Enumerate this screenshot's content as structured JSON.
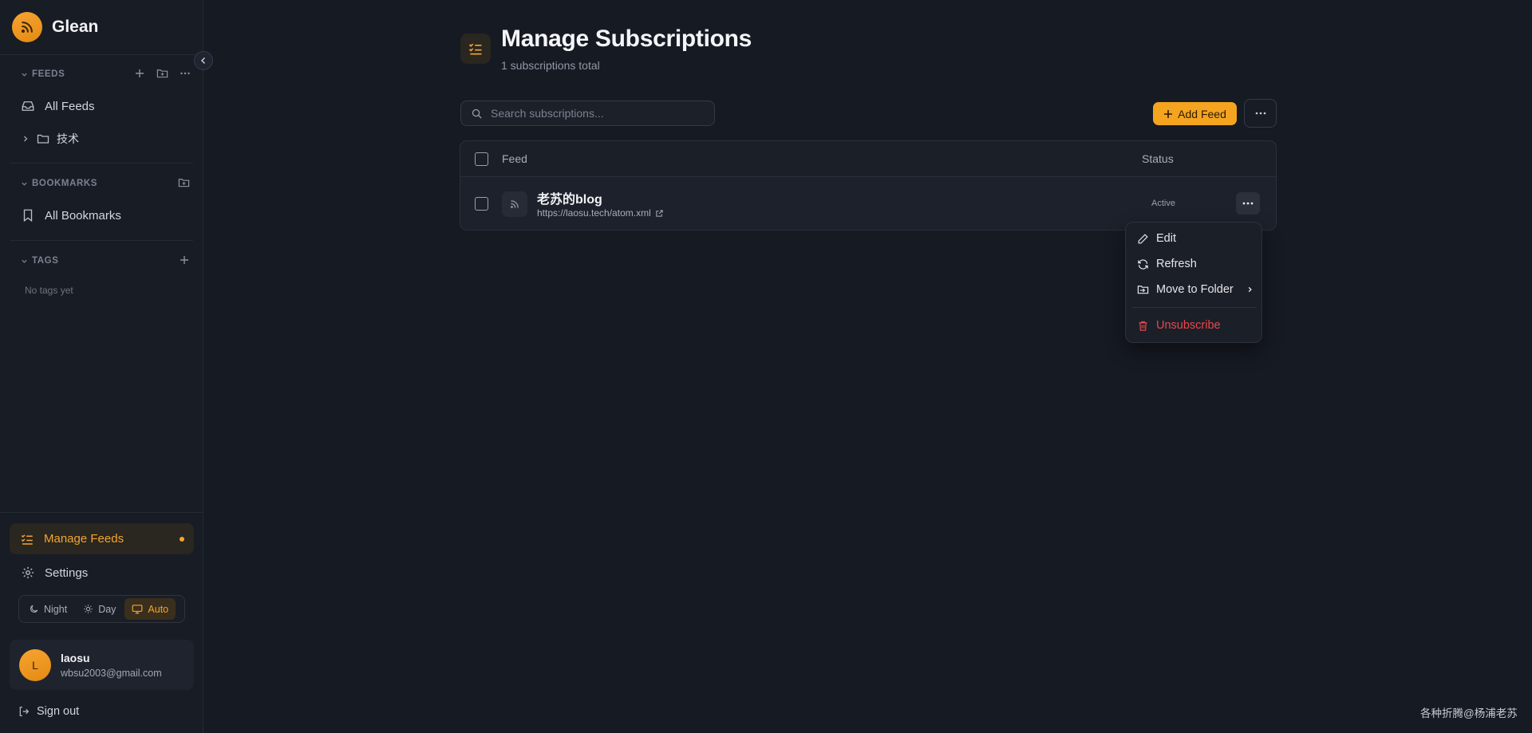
{
  "app": {
    "name": "Glean"
  },
  "sidebar": {
    "feeds": {
      "header": "FEEDS",
      "items": [
        {
          "label": "All Feeds"
        },
        {
          "label": "技术"
        }
      ]
    },
    "bookmarks": {
      "header": "BOOKMARKS",
      "items": [
        {
          "label": "All Bookmarks"
        }
      ]
    },
    "tags": {
      "header": "TAGS",
      "empty_text": "No tags yet"
    },
    "manage_feeds": "Manage Feeds",
    "settings": "Settings",
    "theme": {
      "options": [
        "Night",
        "Day",
        "Auto"
      ],
      "selected": "Auto"
    },
    "user": {
      "initial": "L",
      "name": "laosu",
      "email": "wbsu2003@gmail.com"
    },
    "sign_out": "Sign out"
  },
  "main": {
    "title": "Manage Subscriptions",
    "subtitle": "1 subscriptions total",
    "search_placeholder": "Search subscriptions...",
    "add_feed_label": "Add Feed",
    "table": {
      "columns": [
        "Feed",
        "Status"
      ],
      "rows": [
        {
          "title": "老苏的blog",
          "url": "https://laosu.tech/atom.xml",
          "status": "Active"
        }
      ]
    },
    "row_menu": {
      "items": [
        "Edit",
        "Refresh",
        "Move to Folder",
        "Unsubscribe"
      ]
    }
  },
  "watermark": "各种折腾@杨浦老苏",
  "colors": {
    "accent": "#f4a41f",
    "danger": "#e5484d",
    "background": "#161a23",
    "sidebar": "#181c25"
  }
}
